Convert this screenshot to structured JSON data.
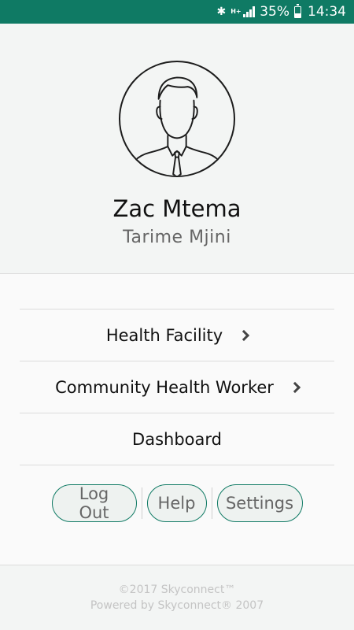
{
  "status_bar": {
    "network_type": "H+",
    "battery_percent": "35%",
    "time": "14:34",
    "icons": [
      "bluetooth-icon",
      "network-type-icon",
      "signal-icon",
      "battery-icon"
    ],
    "background_color": "#0f7a64"
  },
  "profile": {
    "name": "Zac Mtema",
    "location": "Tarime Mjini",
    "avatar_icon": "user-avatar-icon"
  },
  "menu": {
    "items": [
      {
        "label": "Health Facility",
        "has_chevron": true
      },
      {
        "label": "Community Health Worker",
        "has_chevron": true
      },
      {
        "label": "Dashboard",
        "has_chevron": false
      }
    ]
  },
  "actions": {
    "logout_label": "Log Out",
    "help_label": "Help",
    "settings_label": "Settings"
  },
  "footer": {
    "copyright": "©2017 Skyconnect™",
    "powered_by": "Powered by Skyconnect® 2007"
  },
  "colors": {
    "accent": "#0f7a64",
    "header_bg": "#f3f5f4",
    "footer_text": "#c4c4c4"
  }
}
